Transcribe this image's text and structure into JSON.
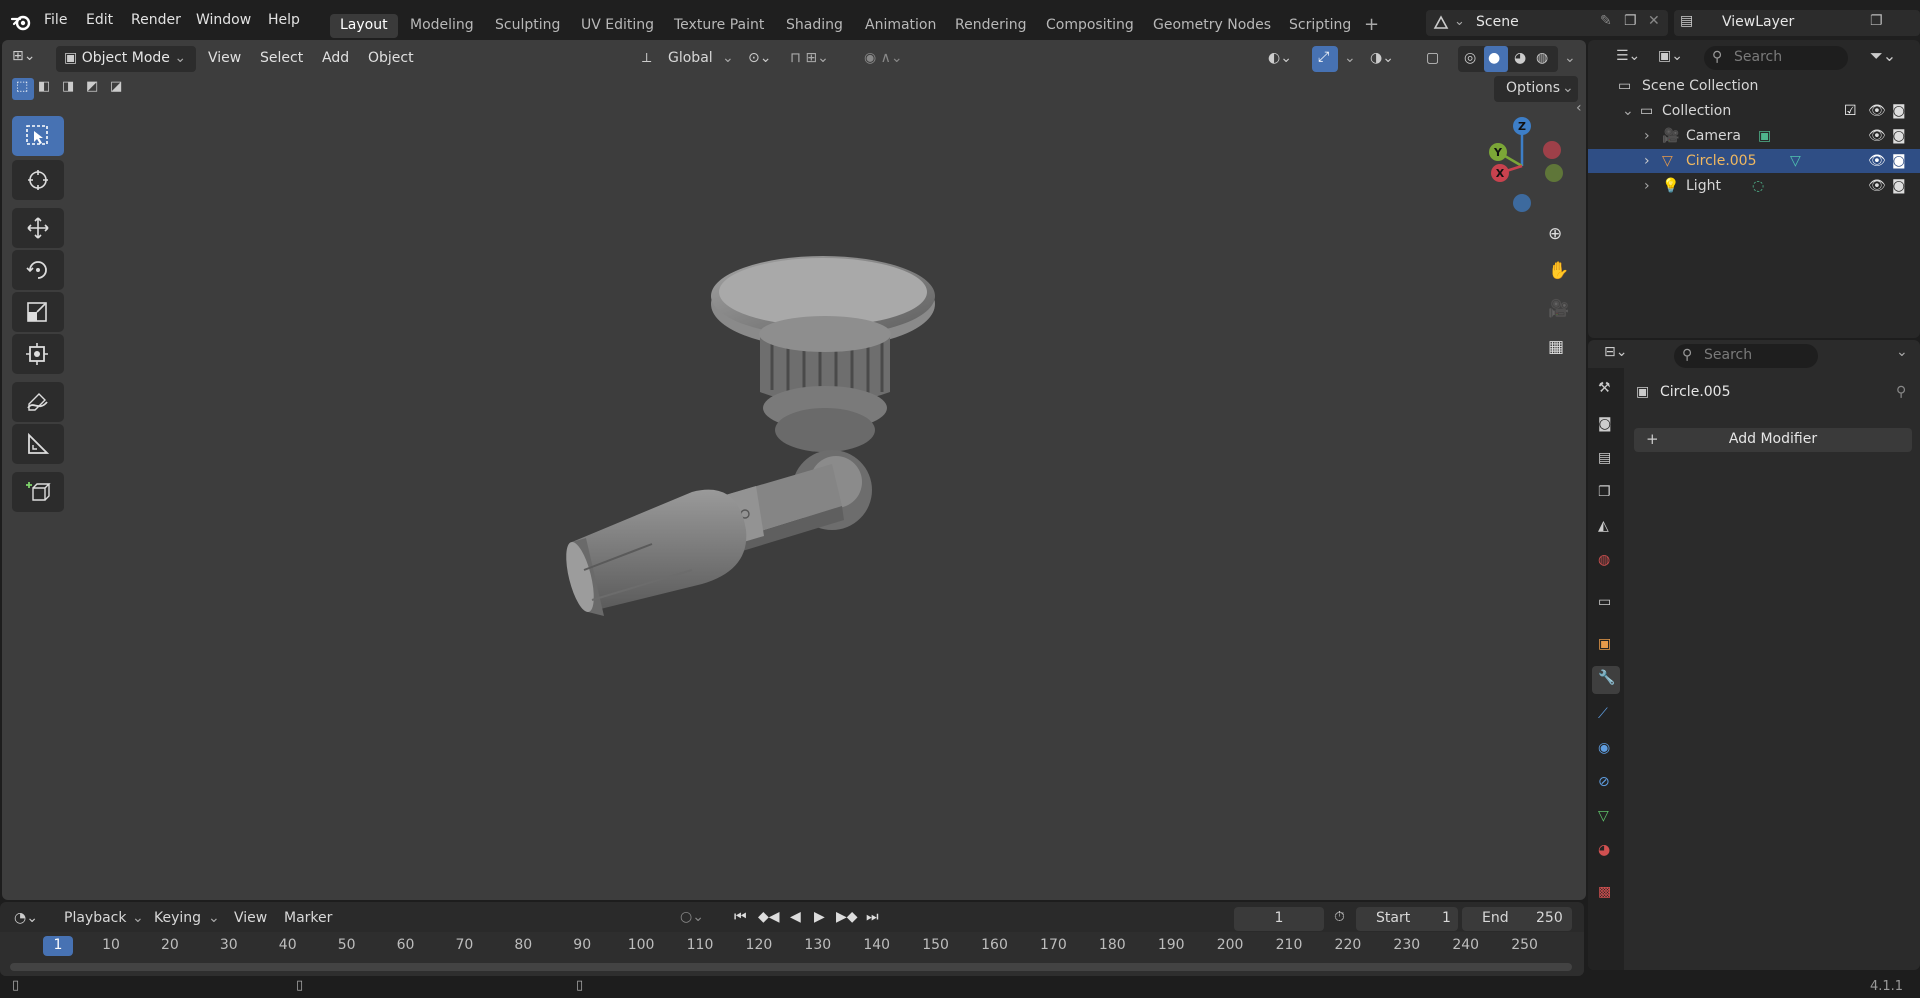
{
  "top_menu": {
    "items": [
      "File",
      "Edit",
      "Render",
      "Window",
      "Help"
    ],
    "workspaces": [
      "Layout",
      "Modeling",
      "Sculpting",
      "UV Editing",
      "Texture Paint",
      "Shading",
      "Animation",
      "Rendering",
      "Compositing",
      "Geometry Nodes",
      "Scripting"
    ],
    "active_workspace": "Layout",
    "scene_name": "Scene",
    "view_layer": "ViewLayer"
  },
  "viewport_header": {
    "mode": "Object Mode",
    "menus": [
      "View",
      "Select",
      "Add",
      "Object"
    ],
    "orientation": "Global",
    "options_label": "Options"
  },
  "outliner": {
    "search_placeholder": "Search",
    "root": "Scene Collection",
    "collection": "Collection",
    "items": [
      {
        "name": "Camera",
        "icon": "camera-icon",
        "selected": false
      },
      {
        "name": "Circle.005",
        "icon": "mesh-icon",
        "selected": true
      },
      {
        "name": "Light",
        "icon": "light-icon",
        "selected": false
      }
    ]
  },
  "properties": {
    "search_placeholder": "Search",
    "object_name": "Circle.005",
    "add_modifier_label": "Add Modifier"
  },
  "timeline": {
    "menus": [
      "Playback",
      "Keying",
      "View",
      "Marker"
    ],
    "current_frame": "1",
    "start_label": "Start",
    "start_value": "1",
    "end_label": "End",
    "end_value": "250",
    "ticks": [
      "1",
      "10",
      "20",
      "30",
      "40",
      "50",
      "60",
      "70",
      "80",
      "90",
      "100",
      "110",
      "120",
      "130",
      "140",
      "150",
      "160",
      "170",
      "180",
      "190",
      "200",
      "210",
      "220",
      "230",
      "240",
      "250"
    ]
  },
  "status": {
    "version": "4.1.1"
  },
  "colors": {
    "accent": "#4772b3",
    "selection": "#2f4e85",
    "axis_x": "#c8424e",
    "axis_y": "#7ba637",
    "axis_z": "#3d7ec7"
  }
}
